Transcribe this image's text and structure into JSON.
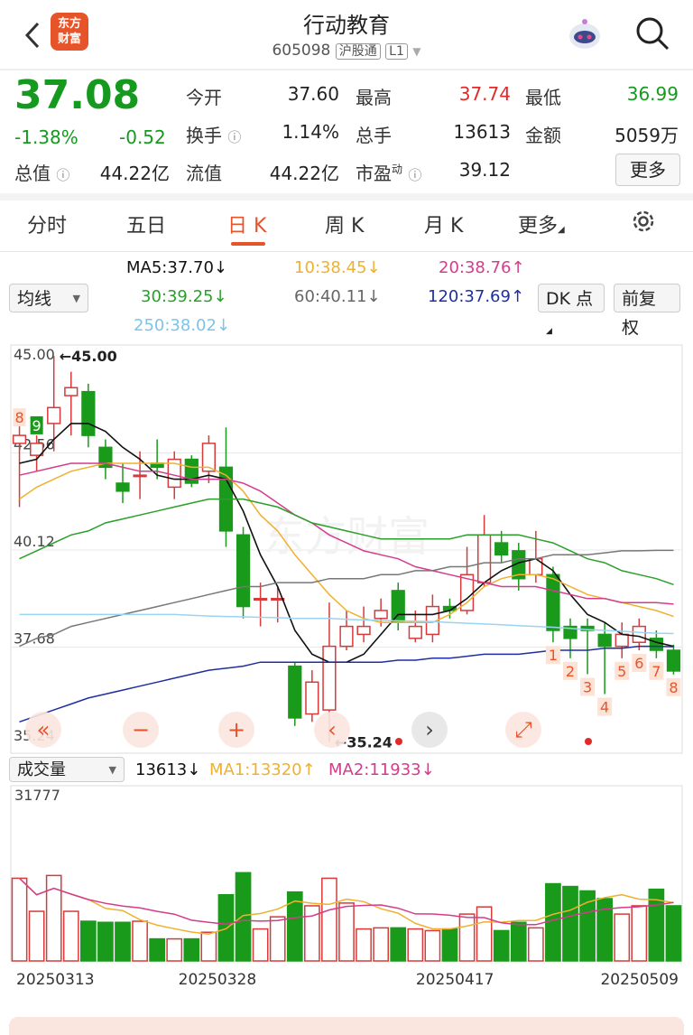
{
  "header": {
    "logo_line1": "东方",
    "logo_line2": "财富",
    "title": "行动教育",
    "code": "605098",
    "tag_hgt": "沪股通",
    "tag_level": "L1"
  },
  "quote": {
    "price": "37.08",
    "pct": "-1.38%",
    "chg": "-0.52",
    "open_label": "今开",
    "open": "37.60",
    "high_label": "最高",
    "high": "37.74",
    "low_label": "最低",
    "low": "36.99",
    "turnover_label": "换手",
    "turnover": "1.14%",
    "volume_label": "总手",
    "volume": "13613",
    "amount_label": "金额",
    "amount": "5059万",
    "mktcap_label": "总值",
    "mktcap": "44.22亿",
    "float_label": "流值",
    "float": "44.22亿",
    "pe_label": "市盈",
    "pe_sup": "动",
    "pe": "39.12",
    "more": "更多"
  },
  "tabs": [
    "分时",
    "五日",
    "日 K",
    "周 K",
    "月 K",
    "更多"
  ],
  "active_tab": 2,
  "ma": {
    "ma5": "MA5:37.70",
    "ma10": "10:38.45",
    "ma20": "20:38.76",
    "ma30": "30:39.25",
    "ma60": "60:40.11",
    "ma120": "120:37.69",
    "ma250": "250:38.02",
    "indicator_select": "均线",
    "dk_button": "DK 点",
    "adjust_button": "前复权"
  },
  "chart_data": {
    "type": "candlestick",
    "y_ticks": [
      "45.00",
      "42.56",
      "40.12",
      "37.68",
      "35.24"
    ],
    "ylim": [
      35.24,
      45.0
    ],
    "high_marker": "45.00",
    "low_marker": "35.24",
    "x_labels": [
      "20250313",
      "20250328",
      "20250417",
      "20250509"
    ],
    "candles": [
      {
        "o": 42.8,
        "c": 43.0,
        "h": 43.4,
        "l": 41.2
      },
      {
        "o": 42.5,
        "c": 42.8,
        "h": 43.0,
        "l": 42.1
      },
      {
        "o": 43.3,
        "c": 43.7,
        "h": 45.0,
        "l": 42.6
      },
      {
        "o": 44.0,
        "c": 44.2,
        "h": 44.6,
        "l": 43.0
      },
      {
        "o": 44.1,
        "c": 43.0,
        "h": 44.3,
        "l": 42.7
      },
      {
        "o": 42.7,
        "c": 42.2,
        "h": 42.9,
        "l": 41.9
      },
      {
        "o": 41.8,
        "c": 41.6,
        "h": 42.3,
        "l": 41.3
      },
      {
        "o": 42.0,
        "c": 42.0,
        "h": 42.6,
        "l": 41.4
      },
      {
        "o": 42.3,
        "c": 42.2,
        "h": 42.9,
        "l": 41.9
      },
      {
        "o": 41.7,
        "c": 42.4,
        "h": 42.6,
        "l": 41.4
      },
      {
        "o": 42.4,
        "c": 41.8,
        "h": 42.5,
        "l": 41.7
      },
      {
        "o": 42.1,
        "c": 42.8,
        "h": 43.0,
        "l": 41.8
      },
      {
        "o": 42.2,
        "c": 40.6,
        "h": 43.2,
        "l": 40.2
      },
      {
        "o": 40.5,
        "c": 38.7,
        "h": 40.7,
        "l": 38.4
      },
      {
        "o": 38.9,
        "c": 38.9,
        "h": 39.3,
        "l": 38.2
      },
      {
        "o": 38.9,
        "c": 38.9,
        "h": 39.2,
        "l": 38.3
      },
      {
        "o": 37.2,
        "c": 35.9,
        "h": 37.3,
        "l": 35.7
      },
      {
        "o": 36.0,
        "c": 36.8,
        "h": 37.1,
        "l": 35.8
      },
      {
        "o": 36.1,
        "c": 37.7,
        "h": 38.8,
        "l": 35.3
      },
      {
        "o": 37.7,
        "c": 38.2,
        "h": 38.6,
        "l": 37.6
      },
      {
        "o": 38.0,
        "c": 38.2,
        "h": 38.7,
        "l": 37.8
      },
      {
        "o": 38.4,
        "c": 38.6,
        "h": 38.9,
        "l": 38.2
      },
      {
        "o": 39.1,
        "c": 38.3,
        "h": 39.3,
        "l": 38.1
      },
      {
        "o": 37.9,
        "c": 38.2,
        "h": 38.6,
        "l": 37.8
      },
      {
        "o": 38.0,
        "c": 38.7,
        "h": 39.0,
        "l": 37.8
      },
      {
        "o": 38.7,
        "c": 38.6,
        "h": 38.9,
        "l": 38.4
      },
      {
        "o": 38.6,
        "c": 39.5,
        "h": 40.2,
        "l": 38.5
      },
      {
        "o": 39.3,
        "c": 40.5,
        "h": 41.0,
        "l": 39.2
      },
      {
        "o": 40.3,
        "c": 40.0,
        "h": 40.6,
        "l": 39.8
      },
      {
        "o": 40.1,
        "c": 39.4,
        "h": 40.3,
        "l": 39.1
      },
      {
        "o": 39.5,
        "c": 39.9,
        "h": 40.6,
        "l": 39.3
      },
      {
        "o": 39.5,
        "c": 38.1,
        "h": 39.7,
        "l": 37.8
      },
      {
        "o": 38.2,
        "c": 37.9,
        "h": 38.4,
        "l": 37.4
      },
      {
        "o": 38.2,
        "c": 38.1,
        "h": 38.4,
        "l": 37.0
      },
      {
        "o": 38.0,
        "c": 37.7,
        "h": 38.3,
        "l": 36.5
      },
      {
        "o": 37.7,
        "c": 38.0,
        "h": 38.3,
        "l": 37.4
      },
      {
        "o": 37.8,
        "c": 38.2,
        "h": 38.4,
        "l": 37.6
      },
      {
        "o": 37.9,
        "c": 37.6,
        "h": 38.1,
        "l": 37.4
      },
      {
        "o": 37.6,
        "c": 37.08,
        "h": 37.74,
        "l": 36.99
      }
    ],
    "ma_lines": [
      {
        "name": "MA5",
        "color": "#111111",
        "y": [
          42.3,
          42.4,
          42.9,
          43.3,
          43.3,
          43.1,
          42.7,
          42.4,
          42.0,
          41.9,
          41.9,
          42.0,
          41.9,
          41.1,
          40.0,
          39.2,
          38.1,
          37.5,
          37.3,
          37.3,
          37.5,
          38.0,
          38.5,
          38.5,
          38.5,
          38.6,
          38.9,
          39.3,
          39.6,
          39.8,
          39.9,
          39.6,
          39.0,
          38.5,
          38.3,
          38.0,
          37.95,
          37.8,
          37.7
        ]
      },
      {
        "name": "MA10",
        "color": "#f0b030",
        "y": [
          41.4,
          41.7,
          41.9,
          42.1,
          42.2,
          42.3,
          42.3,
          42.3,
          42.3,
          42.3,
          42.2,
          42.2,
          42.0,
          41.6,
          41.0,
          40.6,
          40.0,
          39.5,
          39.0,
          38.6,
          38.4,
          38.3,
          38.3,
          38.3,
          38.3,
          38.5,
          38.8,
          39.2,
          39.4,
          39.5,
          39.5,
          39.4,
          39.2,
          39.0,
          38.9,
          38.8,
          38.7,
          38.6,
          38.45
        ]
      },
      {
        "name": "MA20",
        "color": "#d43c8c",
        "y": [
          42.0,
          42.1,
          42.2,
          42.3,
          42.3,
          42.3,
          42.2,
          42.1,
          42.1,
          42.0,
          41.9,
          41.9,
          41.9,
          41.8,
          41.6,
          41.3,
          41.0,
          40.8,
          40.5,
          40.3,
          40.1,
          40.0,
          39.9,
          39.7,
          39.6,
          39.5,
          39.4,
          39.3,
          39.2,
          39.2,
          39.2,
          39.1,
          39.0,
          38.9,
          38.9,
          38.8,
          38.8,
          38.8,
          38.76
        ]
      },
      {
        "name": "MA30",
        "color": "#2aa02a",
        "y": [
          39.9,
          40.1,
          40.3,
          40.5,
          40.6,
          40.8,
          40.9,
          41.0,
          41.1,
          41.2,
          41.3,
          41.4,
          41.4,
          41.4,
          41.3,
          41.2,
          41.0,
          40.8,
          40.7,
          40.6,
          40.5,
          40.4,
          40.4,
          40.4,
          40.4,
          40.4,
          40.5,
          40.5,
          40.5,
          40.5,
          40.4,
          40.3,
          40.1,
          39.9,
          39.8,
          39.6,
          39.5,
          39.4,
          39.25
        ]
      },
      {
        "name": "MA60",
        "color": "#777777",
        "y": [
          37.7,
          37.9,
          38.0,
          38.2,
          38.3,
          38.4,
          38.5,
          38.6,
          38.7,
          38.8,
          38.9,
          39.0,
          39.1,
          39.2,
          39.2,
          39.3,
          39.3,
          39.3,
          39.4,
          39.4,
          39.4,
          39.5,
          39.5,
          39.6,
          39.6,
          39.7,
          39.7,
          39.8,
          39.8,
          39.9,
          39.9,
          40.0,
          40.0,
          40.0,
          40.05,
          40.1,
          40.1,
          40.11,
          40.11
        ]
      },
      {
        "name": "MA120",
        "color": "#1f2fa0",
        "y": [
          35.8,
          35.95,
          36.1,
          36.25,
          36.4,
          36.5,
          36.6,
          36.7,
          36.8,
          36.9,
          37.0,
          37.1,
          37.15,
          37.2,
          37.3,
          37.3,
          37.3,
          37.3,
          37.3,
          37.3,
          37.3,
          37.3,
          37.35,
          37.35,
          37.4,
          37.4,
          37.45,
          37.5,
          37.5,
          37.5,
          37.55,
          37.6,
          37.6,
          37.6,
          37.65,
          37.65,
          37.7,
          37.7,
          37.69
        ]
      },
      {
        "name": "MA250",
        "color": "#9ad4f2",
        "y": [
          38.5,
          38.5,
          38.5,
          38.5,
          38.5,
          38.5,
          38.5,
          38.5,
          38.5,
          38.5,
          38.48,
          38.46,
          38.45,
          38.44,
          38.43,
          38.42,
          38.4,
          38.4,
          38.4,
          38.38,
          38.36,
          38.35,
          38.34,
          38.33,
          38.32,
          38.3,
          38.28,
          38.26,
          38.24,
          38.22,
          38.2,
          38.18,
          38.15,
          38.12,
          38.1,
          38.08,
          38.05,
          38.03,
          38.02
        ]
      }
    ],
    "signals_top": [
      {
        "i": 0,
        "label": "8"
      },
      {
        "i": 1,
        "label": "9"
      }
    ],
    "signals_bottom": [
      {
        "i": 31,
        "label": "1"
      },
      {
        "i": 32,
        "label": "2"
      },
      {
        "i": 33,
        "label": "3"
      },
      {
        "i": 34,
        "label": "4"
      },
      {
        "i": 35,
        "label": "5"
      },
      {
        "i": 36,
        "label": "6"
      },
      {
        "i": 37,
        "label": "7"
      },
      {
        "i": 38,
        "label": "8"
      }
    ]
  },
  "volume": {
    "select_label": "成交量",
    "vol_value": "13613",
    "ma1": "MA1:13320",
    "ma2": "MA2:11933",
    "y_max": "31777",
    "values": [
      15000,
      9000,
      15500,
      9000,
      7200,
      7000,
      7000,
      7200,
      4000,
      4000,
      4000,
      5200,
      12000,
      16000,
      5800,
      8000,
      12500,
      10000,
      15000,
      10500,
      5800,
      6000,
      6000,
      5800,
      5500,
      5800,
      8500,
      9800,
      5500,
      7000,
      6000,
      14000,
      13500,
      12700,
      11300,
      8500,
      10000,
      13000,
      10000
    ]
  },
  "controls": {
    "left2": "«",
    "zoom_out": "−",
    "zoom_in": "+",
    "prev": "‹",
    "next": "›",
    "fullscreen": "⤢"
  }
}
